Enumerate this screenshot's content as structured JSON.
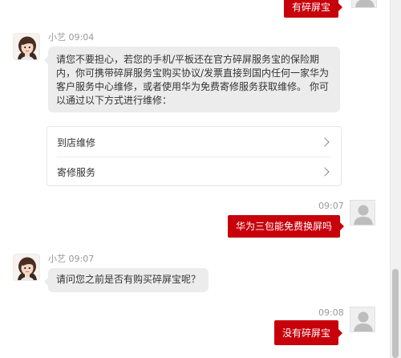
{
  "messages": {
    "m1": {
      "text": "有碎屏宝"
    },
    "m2": {
      "sender": "小艺",
      "time": "09:04",
      "lines": [
        "请您不要担心，若您的手机/平板还在官方碎屏服务宝的保险期",
        "内，你可携带碎屏服务宝购买协议/发票直接到国内任何一家华为",
        "客户服务中心维修，或者使用华为免费寄修服务获取维修。 你可",
        "以通过以下方式进行维修："
      ]
    },
    "options": [
      {
        "label": "到店维修"
      },
      {
        "label": "寄修服务"
      }
    ],
    "m3": {
      "time": "09:07",
      "text": "华为三包能免费换屏吗"
    },
    "m4": {
      "sender": "小艺",
      "time": "09:07",
      "text": "请问您之前是否有购买碎屏宝呢？"
    },
    "m5": {
      "time": "09:08",
      "text": "没有碎屏宝"
    }
  },
  "colors": {
    "accent": "#c7000b",
    "bot_bubble": "#ececec"
  },
  "icons": {
    "user_avatar": "person-silhouette-icon",
    "bot_avatar": "assistant-avatar-icon",
    "option_arrow": "chevron-right-icon"
  }
}
